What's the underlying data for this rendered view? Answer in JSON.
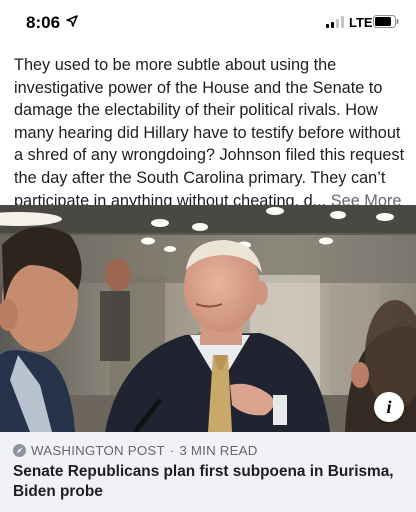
{
  "status_bar": {
    "time": "8:06",
    "network": "LTE"
  },
  "post": {
    "text": "They used to be more subtle about using the investigative power of the House and the Senate to damage the electability of their political rivals. How many hearing did Hillary have to testify before without a shred of any wrongdoing? Johnson filed this request the day after the South Carolina primary. They can’t participate in anything without cheating, d...",
    "see_more_label": "See More"
  },
  "link_preview": {
    "source": "WASHINGTON POST",
    "separator": "·",
    "read_time": "3 MIN READ",
    "headline": "Senate Republicans plan first subpoena in Burisma, Biden probe",
    "info_label": "i"
  },
  "colors": {
    "text_primary": "#1c1e21",
    "text_secondary": "#65676b",
    "footer_bg": "#f0f2f5"
  },
  "icons": {
    "location": "location-arrow-icon",
    "signal": "cellular-signal-icon",
    "battery": "battery-icon",
    "source": "compass-icon",
    "info": "info-icon"
  }
}
